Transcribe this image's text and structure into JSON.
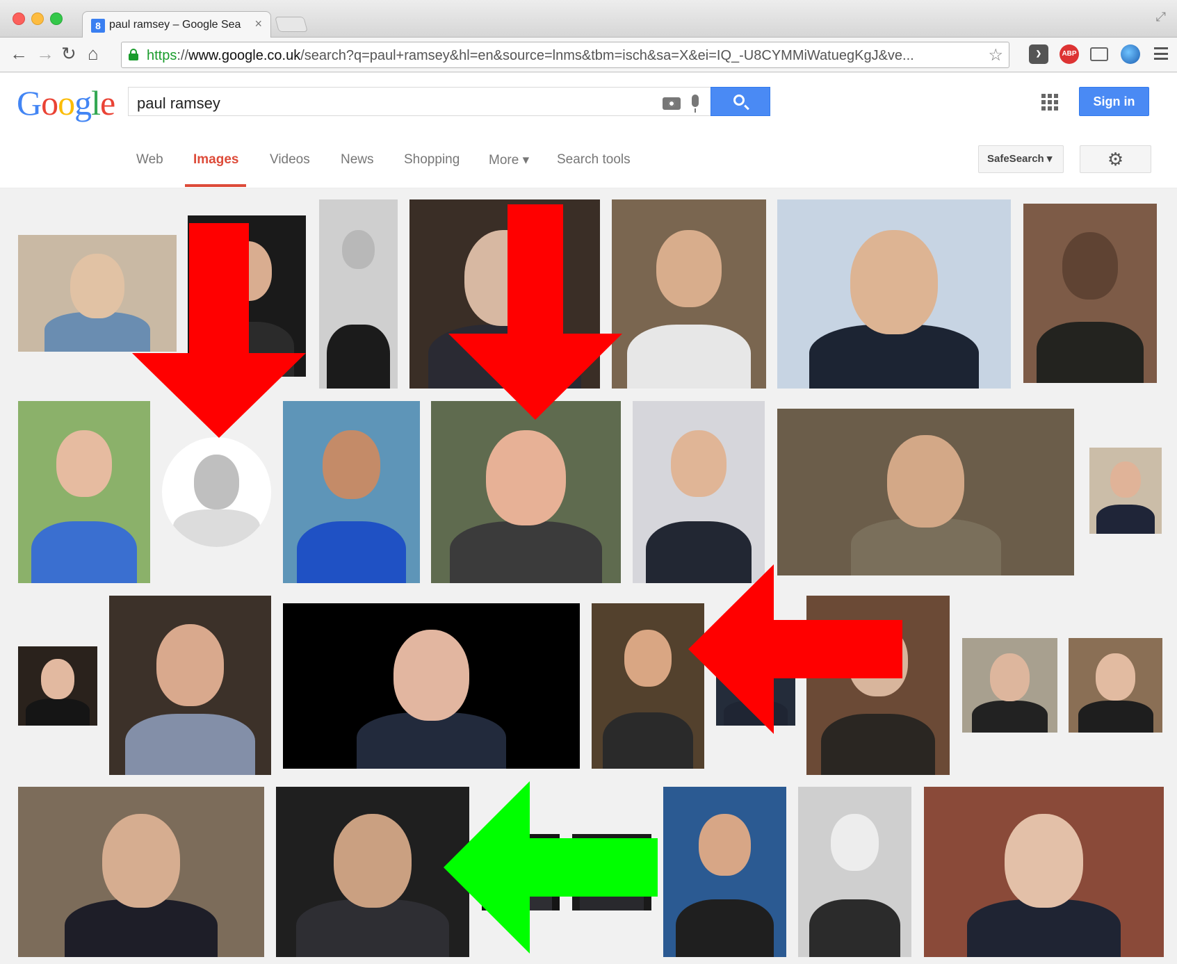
{
  "browser": {
    "tab_title": "paul ramsey – Google Sear",
    "tab_favicon": "8",
    "tab_close": "×",
    "url_scheme": "https",
    "url_sep": "://",
    "url_host": "www.google.co.uk",
    "url_path": "/search?q=paul+ramsey&hl=en&source=lnms&tbm=isch&sa=X&ei=IQ_-U8CYMMiWatuegKgJ&ve...",
    "ext_abp": "ABP",
    "icons": [
      "back-arrow-icon",
      "forward-arrow-icon",
      "reload-icon",
      "home-icon",
      "lock-icon",
      "bookmark-star-icon",
      "pocket-icon",
      "adblock-plus-icon",
      "cast-icon",
      "globe-icon",
      "menu-icon"
    ]
  },
  "google": {
    "logo_letters": [
      {
        "ch": "G",
        "color": "#4285f4"
      },
      {
        "ch": "o",
        "color": "#ea4335"
      },
      {
        "ch": "o",
        "color": "#fbbc05"
      },
      {
        "ch": "g",
        "color": "#4285f4"
      },
      {
        "ch": "l",
        "color": "#34a853"
      },
      {
        "ch": "e",
        "color": "#ea4335"
      }
    ],
    "query": "paul ramsey",
    "signin": "Sign in"
  },
  "nav": {
    "items": [
      "Web",
      "Images",
      "Videos",
      "News",
      "Shopping",
      "More ▾",
      "Search tools"
    ],
    "active": "Images",
    "safesearch": "SafeSearch ▾",
    "settings_icon": "⚙"
  },
  "colors": {
    "google_blue": "#4a8af4",
    "active_tab": "#dd4b39",
    "arrow_red": "#ff0000",
    "arrow_green": "#00ff00"
  },
  "results": {
    "rows": 4,
    "thumbnail_count": 30,
    "annotations": [
      {
        "type": "arrow",
        "color": "red",
        "direction": "down"
      },
      {
        "type": "arrow",
        "color": "red",
        "direction": "down"
      },
      {
        "type": "arrow",
        "color": "red",
        "direction": "left"
      },
      {
        "type": "arrow",
        "color": "green",
        "direction": "left"
      }
    ]
  }
}
